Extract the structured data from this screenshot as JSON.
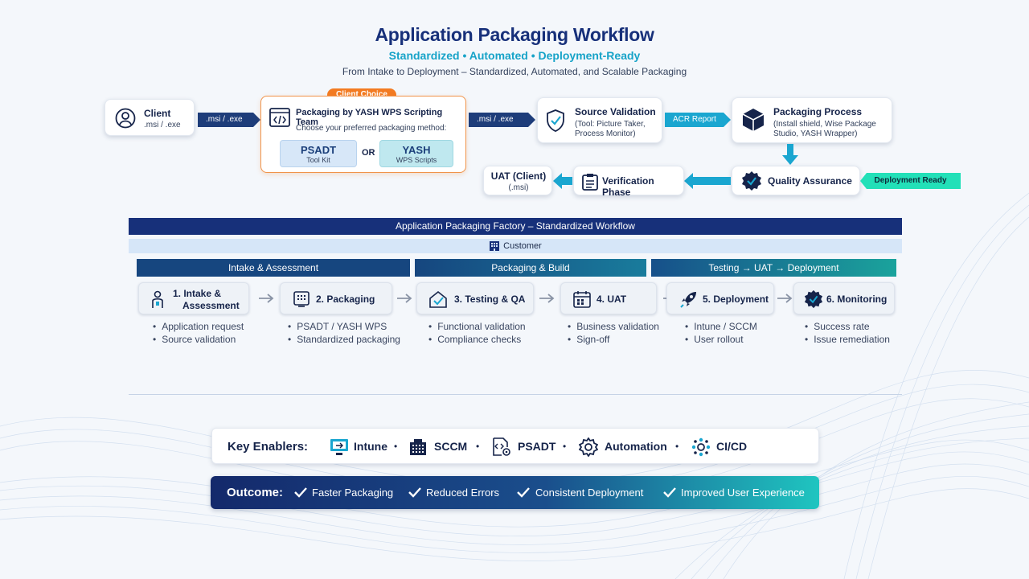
{
  "header": {
    "title": "Application Packaging Workflow",
    "subtitle": "Standardized • Automated • Deployment-Ready",
    "tagline": "From Intake to Deployment – Standardized, Automated, and Scalable Packaging"
  },
  "top_flow": {
    "client": {
      "title": "Client",
      "sub": ".msi / .exe"
    },
    "arrow1": ".msi / .exe",
    "client_choice": "Client Choice",
    "packaging": {
      "title": "Packaging by YASH WPS Scripting Team",
      "sub": "Choose your preferred packaging method:",
      "option1_big": "PSADT",
      "option1_small": "Tool Kit",
      "or": "OR",
      "option2_big": "YASH",
      "option2_small": "WPS Scripts"
    },
    "arrow2": ".msi / .exe",
    "source_validation": {
      "title": "Source Validation",
      "sub1": "(Tool: Picture Taker,",
      "sub2": "Process Monitor)"
    },
    "arrow3": "ACR Report",
    "packaging_process": {
      "title": "Packaging Process",
      "sub1": "(Install shield, Wise Package",
      "sub2": "Studio, YASH Wrapper)"
    },
    "quality_assurance": "Quality Assurance",
    "deployment_ready": "Deployment Ready",
    "verification": "Verification Phase",
    "uat": {
      "title": "UAT (Client)",
      "sub": "(.msi)"
    }
  },
  "factory": {
    "title": "Application Packaging Factory – Standardized Workflow",
    "customer": "Customer",
    "phases": [
      "Intake & Assessment",
      "Packaging & Build",
      "Testing → UAT → Deployment"
    ],
    "steps": [
      {
        "label1": "1. Intake &",
        "label2": "Assessment",
        "bullets": [
          "Application request",
          "Source validation"
        ]
      },
      {
        "label1": "2. Packaging",
        "label2": "",
        "bullets": [
          "PSADT / YASH WPS",
          "Standardized packaging"
        ]
      },
      {
        "label1": "3. Testing & QA",
        "label2": "",
        "bullets": [
          "Functional validation",
          "Compliance checks"
        ]
      },
      {
        "label1": "4. UAT",
        "label2": "",
        "bullets": [
          "Business validation",
          "Sign-off"
        ]
      },
      {
        "label1": "5. Deployment",
        "label2": "",
        "bullets": [
          "Intune / SCCM",
          "User rollout"
        ]
      },
      {
        "label1": "6. Monitoring",
        "label2": "",
        "bullets": [
          "Success rate",
          "Issue remediation"
        ]
      }
    ]
  },
  "enablers": {
    "label": "Key Enablers:",
    "items": [
      "Intune",
      "SCCM",
      "PSADT",
      "Automation",
      "CI/CD"
    ]
  },
  "outcome": {
    "label": "Outcome:",
    "items": [
      "Faster Packaging",
      "Reduced Errors",
      "Consistent Deployment",
      "Improved User Experience"
    ]
  },
  "colors": {
    "navy": "#17307a",
    "cyan": "#17a3c8",
    "orange": "#f37b22",
    "teal": "#22e0b8"
  }
}
